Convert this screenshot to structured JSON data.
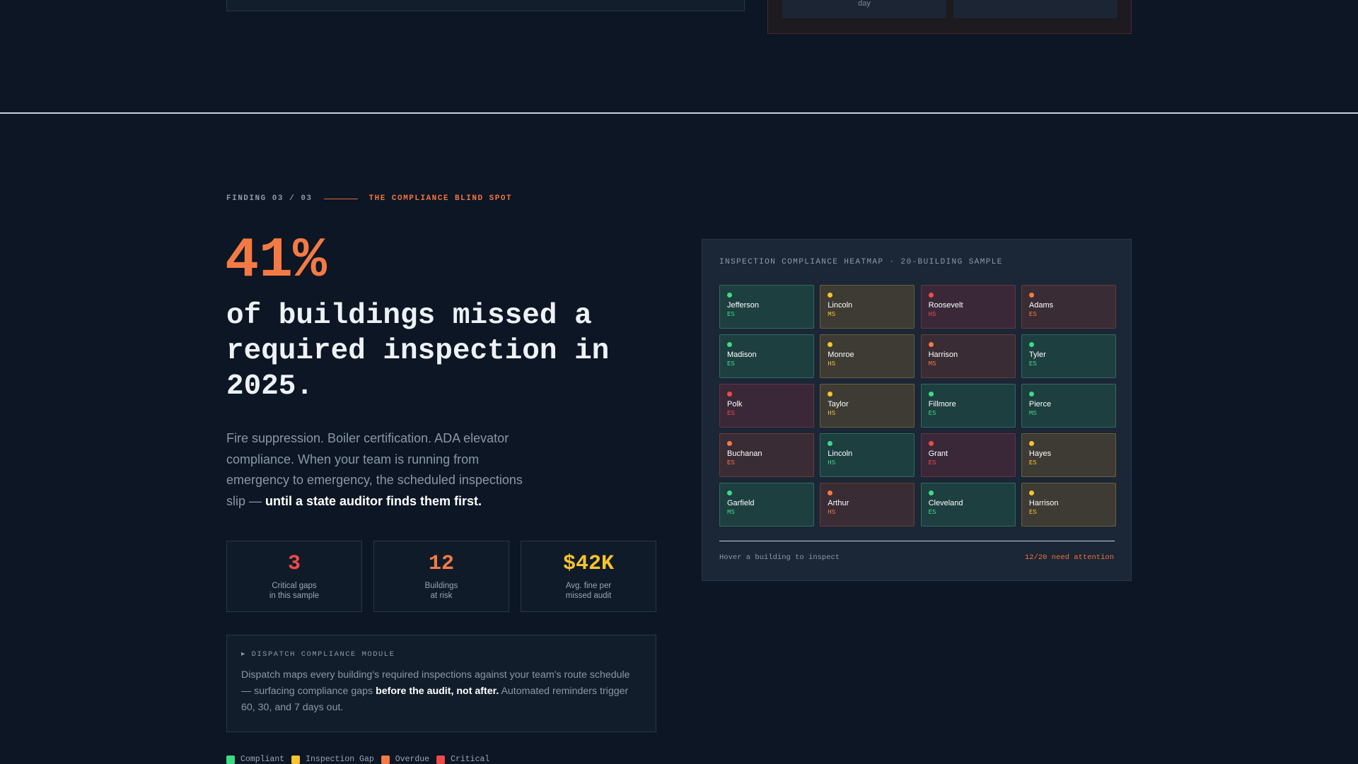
{
  "previous_section": {
    "day_label": "day"
  },
  "finding": {
    "index": "FINDING 03 / 03",
    "tag": "THE COMPLIANCE BLIND SPOT",
    "big_stat": "41%",
    "headline": "of buildings missed a required inspection in 2025.",
    "body_plain": "Fire suppression. Boiler certification. ADA elevator compliance. When your team is running from emergency to emergency, the scheduled inspections slip — ",
    "body_strong": "until a state auditor finds them first."
  },
  "stats": [
    {
      "value": "3",
      "label_line1": "Critical gaps",
      "label_line2": "in this sample"
    },
    {
      "value": "12",
      "label_line1": "Buildings",
      "label_line2": "at risk"
    },
    {
      "value": "$42K",
      "label_line1": "Avg. fine per",
      "label_line2": "missed audit"
    }
  ],
  "module": {
    "title": "▸ DISPATCH COMPLIANCE MODULE",
    "text_1": "Dispatch maps every building's required inspections against your team's route schedule — surfacing compliance gaps ",
    "text_strong": "before the audit, not after.",
    "text_2": " Automated reminders trigger 60, 30, and 7 days out."
  },
  "legend": [
    {
      "label": "Compliant",
      "color": "#3ddc84"
    },
    {
      "label": "Inspection Gap",
      "color": "#f7c42e"
    },
    {
      "label": "Overdue",
      "color": "#f47a45"
    },
    {
      "label": "Critical",
      "color": "#ef4a4a"
    }
  ],
  "heatmap": {
    "title": "INSPECTION COMPLIANCE HEATMAP · 20-BUILDING SAMPLE",
    "hint": "Hover a building to inspect",
    "attention": "12/20 need attention",
    "buildings": [
      {
        "name": "Jefferson",
        "level": "ES",
        "status": "compliant"
      },
      {
        "name": "Lincoln",
        "level": "MS",
        "status": "gap"
      },
      {
        "name": "Roosevelt",
        "level": "HS",
        "status": "critical"
      },
      {
        "name": "Adams",
        "level": "ES",
        "status": "overdue"
      },
      {
        "name": "Madison",
        "level": "ES",
        "status": "compliant"
      },
      {
        "name": "Monroe",
        "level": "HS",
        "status": "gap"
      },
      {
        "name": "Harrison",
        "level": "MS",
        "status": "overdue"
      },
      {
        "name": "Tyler",
        "level": "ES",
        "status": "compliant"
      },
      {
        "name": "Polk",
        "level": "ES",
        "status": "critical"
      },
      {
        "name": "Taylor",
        "level": "HS",
        "status": "gap"
      },
      {
        "name": "Fillmore",
        "level": "ES",
        "status": "compliant"
      },
      {
        "name": "Pierce",
        "level": "MS",
        "status": "compliant"
      },
      {
        "name": "Buchanan",
        "level": "ES",
        "status": "overdue"
      },
      {
        "name": "Lincoln",
        "level": "HS",
        "status": "compliant"
      },
      {
        "name": "Grant",
        "level": "ES",
        "status": "critical"
      },
      {
        "name": "Hayes",
        "level": "ES",
        "status": "gap"
      },
      {
        "name": "Garfield",
        "level": "MS",
        "status": "compliant"
      },
      {
        "name": "Arthur",
        "level": "HS",
        "status": "overdue"
      },
      {
        "name": "Cleveland",
        "level": "ES",
        "status": "compliant"
      },
      {
        "name": "Harrison",
        "level": "ES",
        "status": "gap"
      }
    ]
  }
}
